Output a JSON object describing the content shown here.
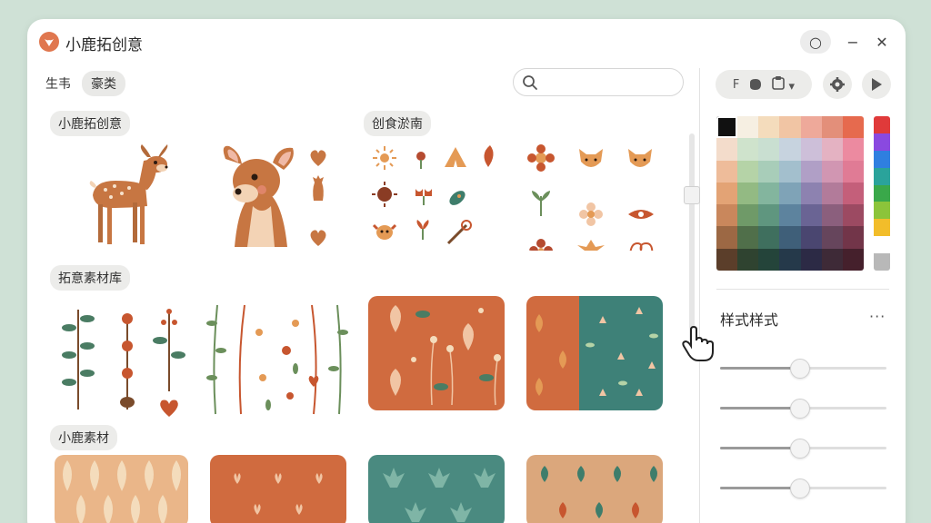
{
  "app": {
    "title": "小鹿拓创意"
  },
  "window_controls": {
    "record": "○",
    "minimize": "−",
    "close": "✕"
  },
  "tabs": [
    {
      "label": "生韦"
    },
    {
      "label": "豪类"
    }
  ],
  "search": {
    "placeholder": "",
    "value": ""
  },
  "sections": [
    {
      "label": "小鹿拓创意"
    },
    {
      "label": "创食淤南"
    },
    {
      "label": "拓意素材库"
    },
    {
      "label": "小鹿素材"
    }
  ],
  "right_panel": {
    "toolbar": {
      "sort_label": "F",
      "dropdown_label": "▾"
    },
    "style_title": "样式样式",
    "more": "···",
    "sliders": [
      {
        "value": 0.48
      },
      {
        "value": 0.48
      },
      {
        "value": 0.48
      },
      {
        "value": 0.48
      }
    ],
    "palette_colors": [
      "#111111",
      "#f6efe2",
      "#f4dcbc",
      "#f1c5a4",
      "#eea99a",
      "#e38f7a",
      "#e66a4e",
      "#f3dccb",
      "#cfe3cc",
      "#c9dfd1",
      "#c7d3df",
      "#cdbfd9",
      "#e4b2c2",
      "#ec8aa0",
      "#eebc9a",
      "#b5d3a7",
      "#a8cdb9",
      "#a3bfcd",
      "#b09fc6",
      "#d196b2",
      "#e07b95",
      "#e3a375",
      "#93ba83",
      "#83b59e",
      "#7fa3b7",
      "#8d82b0",
      "#b27b9a",
      "#c45f7a",
      "#c9875c",
      "#6f9a68",
      "#5f967f",
      "#5d839e",
      "#6a6494",
      "#8b5f7d",
      "#9c4a62",
      "#9c6844",
      "#506f4a",
      "#3f6f5e",
      "#3f5f79",
      "#4a4670",
      "#66455c",
      "#723549",
      "#5b3e2a",
      "#2f4330",
      "#24443a",
      "#25394a",
      "#2c2a45",
      "#3e2a37",
      "#45202c"
    ],
    "hue_colors": [
      "#e03a3a",
      "#8a49e0",
      "#2f7fe0",
      "#2aa39b",
      "#3aa84a",
      "#8cc43a",
      "#f2bd2a",
      "#ffffff",
      "#b8b8b8"
    ]
  }
}
